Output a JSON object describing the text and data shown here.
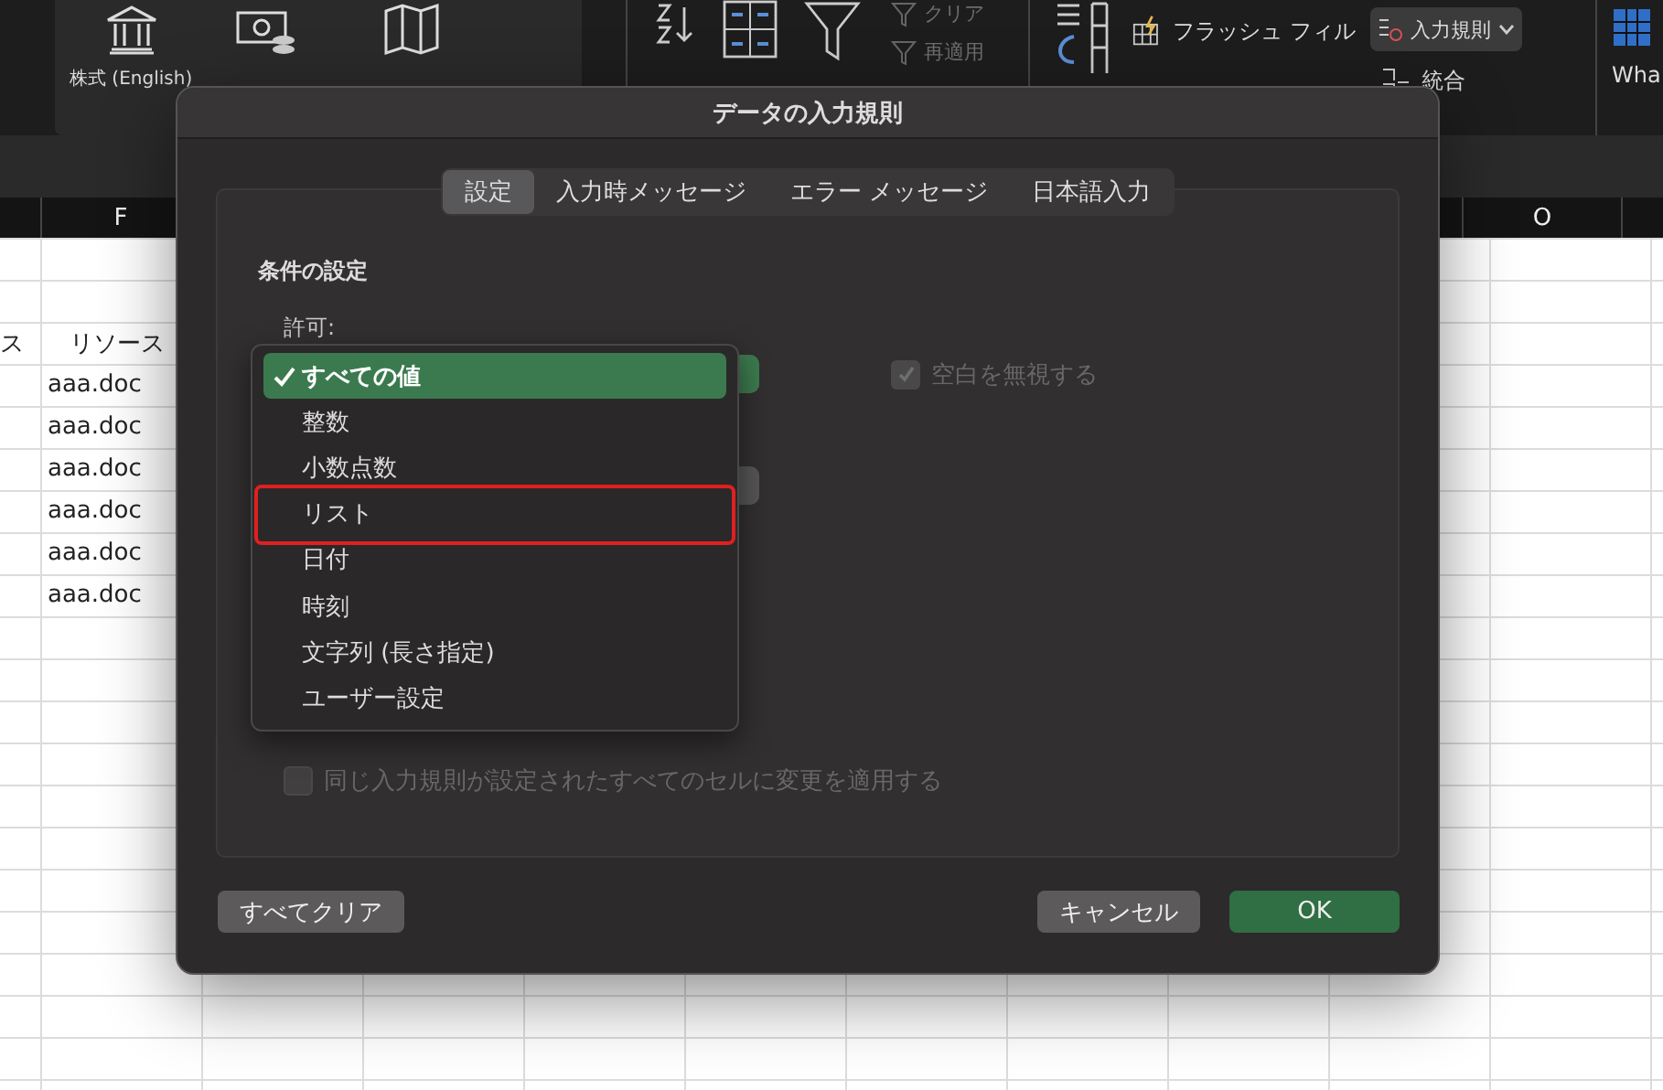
{
  "ribbon": {
    "data_types": [
      {
        "label": "株式 (English)",
        "kind": "bank"
      }
    ],
    "sort_filter": {
      "clear": "クリア",
      "reapply": "再適用"
    },
    "tools": {
      "flash_fill": "フラッシュ フィル",
      "validation": "入力規則",
      "consolidate": "統合",
      "what_if": "Wha"
    }
  },
  "sheet": {
    "columns": [
      "",
      "F",
      "O"
    ],
    "rows": [
      [
        "",
        "",
        ""
      ],
      [
        "",
        "",
        ""
      ],
      [
        "ス",
        "リソース",
        ""
      ],
      [
        "",
        "aaa.doc",
        ""
      ],
      [
        "",
        "aaa.doc",
        ""
      ],
      [
        "",
        "aaa.doc",
        ""
      ],
      [
        "",
        "aaa.doc",
        ""
      ],
      [
        "",
        "aaa.doc",
        ""
      ],
      [
        "",
        "aaa.doc",
        ""
      ]
    ]
  },
  "dialog": {
    "title": "データの入力規則",
    "tabs": [
      {
        "label": "設定",
        "selected": true
      },
      {
        "label": "入力時メッセージ",
        "selected": false
      },
      {
        "label": "エラー メッセージ",
        "selected": false
      },
      {
        "label": "日本語入力",
        "selected": false
      }
    ],
    "section_title": "条件の設定",
    "allow_label": "許可:",
    "allow_menu": [
      {
        "label": "すべての値",
        "selected": true,
        "highlighted": false
      },
      {
        "label": "整数",
        "selected": false,
        "highlighted": false
      },
      {
        "label": "小数点数",
        "selected": false,
        "highlighted": false
      },
      {
        "label": "リスト",
        "selected": false,
        "highlighted": true
      },
      {
        "label": "日付",
        "selected": false,
        "highlighted": false
      },
      {
        "label": "時刻",
        "selected": false,
        "highlighted": false
      },
      {
        "label": "文字列 (長さ指定)",
        "selected": false,
        "highlighted": false
      },
      {
        "label": "ユーザー設定",
        "selected": false,
        "highlighted": false
      }
    ],
    "ignore_blank": {
      "label": "空白を無視する",
      "checked": true,
      "disabled": true
    },
    "apply_all": {
      "label": "同じ入力規則が設定されたすべてのセルに変更を適用する",
      "checked": false,
      "disabled": true
    },
    "buttons": [
      {
        "label": "すべてクリア",
        "kind": "secondary"
      },
      {
        "label": "キャンセル",
        "kind": "secondary"
      },
      {
        "label": "OK",
        "kind": "primary"
      }
    ]
  }
}
